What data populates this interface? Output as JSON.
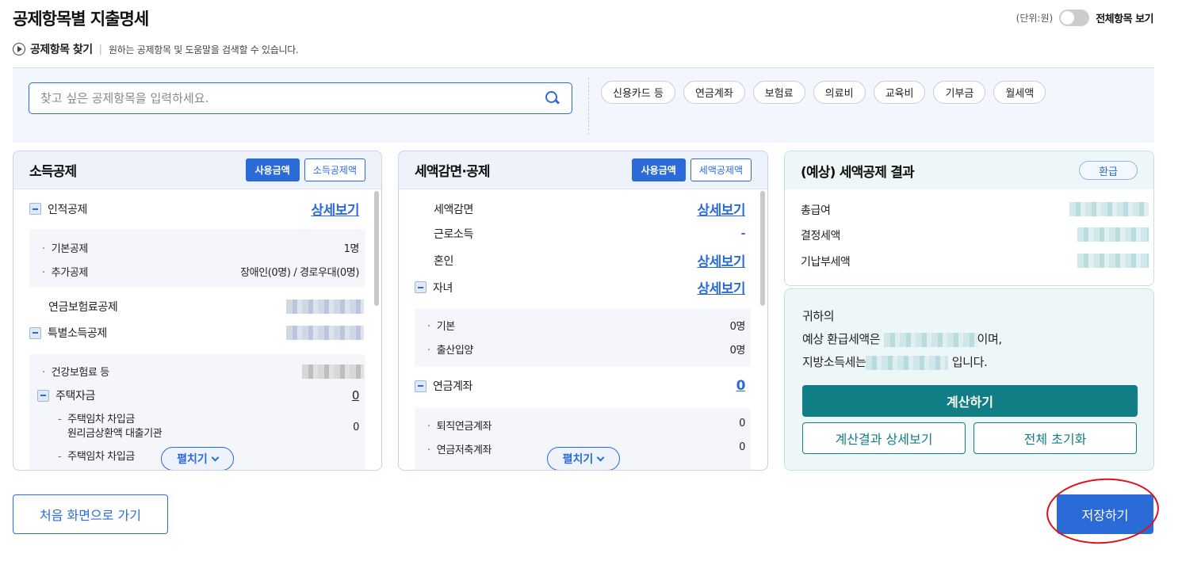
{
  "page": {
    "title": "공제항목별 지출명세",
    "unit": "(단위:원)",
    "toggle_label": "전체항목 보기"
  },
  "finder": {
    "title": "공제항목 찾기",
    "description": "원하는 공제항목 및 도움말을 검색할 수 있습니다.",
    "search_placeholder": "찾고 싶은 공제항목을 입력하세요.",
    "chips": [
      "신용카드 등",
      "연금계좌",
      "보험료",
      "의료비",
      "교육비",
      "기부금",
      "월세액"
    ]
  },
  "income_deduction": {
    "title": "소득공제",
    "btn_used": "사용금액",
    "btn_deduct": "소득공제액",
    "personal": {
      "label": "인적공제",
      "link": "상세보기"
    },
    "basic": {
      "label": "기본공제",
      "value": "1명"
    },
    "additional": {
      "label": "추가공제",
      "value": "장애인(0명) / 경로우대(0명)"
    },
    "pension": {
      "label": "연금보험료공제"
    },
    "special": {
      "label": "특별소득공제"
    },
    "health": {
      "label": "건강보험료 등"
    },
    "housing": {
      "label": "주택자금",
      "value": "0"
    },
    "rent_loan_1": {
      "label_line1": "주택임차 차입금",
      "label_line2": "원리금상환액 대출기관",
      "value": "0"
    },
    "rent_loan_2": {
      "label": "주택임차 차입금"
    },
    "expand": "펼치기"
  },
  "tax_credit": {
    "title": "세액감면·공제",
    "btn_used": "사용금액",
    "btn_credit": "세액공제액",
    "reduction": {
      "label": "세액감면",
      "link": "상세보기"
    },
    "earned": {
      "label": "근로소득",
      "value": "-"
    },
    "marriage": {
      "label": "혼인",
      "link": "상세보기"
    },
    "children": {
      "label": "자녀",
      "link": "상세보기"
    },
    "child_basic": {
      "label": "기본",
      "value": "0명"
    },
    "child_birth": {
      "label": "출산입양",
      "value": "0명"
    },
    "pension_account": {
      "label": "연금계좌",
      "value": "0"
    },
    "retirement": {
      "label": "퇴직연금계좌",
      "value": "0"
    },
    "savings": {
      "label": "연금저축계좌",
      "value": "0"
    },
    "expand": "펼치기"
  },
  "result": {
    "title": "(예상) 세액공제 결과",
    "badge": "환급",
    "rows": [
      "총급여",
      "결정세액",
      "기납부세액"
    ],
    "msg_line1": "귀하의",
    "msg_line2_pre": "예상 환급세액은",
    "msg_line2_post": "이며,",
    "msg_line3_pre": "지방소득세는",
    "msg_line3_post": "입니다.",
    "calc_btn": "계산하기",
    "detail_btn": "계산결과 상세보기",
    "reset_btn": "전체 초기화"
  },
  "footer": {
    "home_btn": "처음 화면으로 가기",
    "save_btn": "저장하기"
  },
  "colors": {
    "primary": "#2a6bd8",
    "teal": "#117d85",
    "annotation": "#e0101a"
  }
}
